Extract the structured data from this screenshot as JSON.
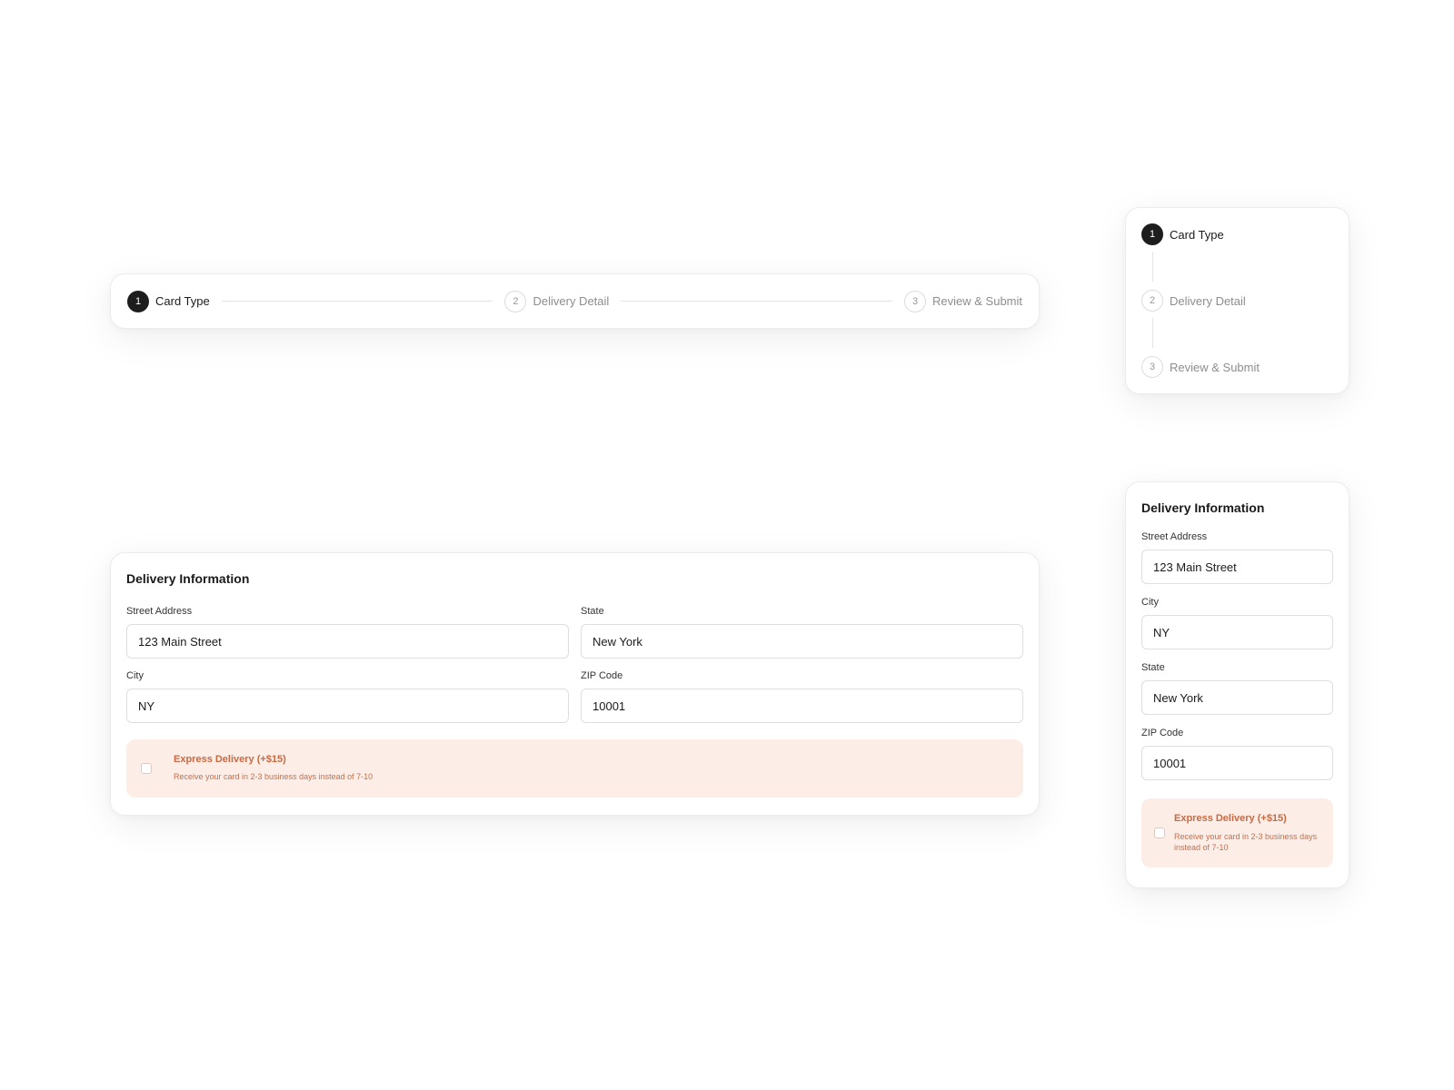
{
  "stepper": {
    "steps": [
      {
        "number": "1",
        "label": "Card Type",
        "state": "active"
      },
      {
        "number": "2",
        "label": "Delivery Detail",
        "state": "inactive"
      },
      {
        "number": "3",
        "label": "Review & Submit",
        "state": "inactive"
      }
    ]
  },
  "delivery_form": {
    "title": "Delivery Information",
    "fields": {
      "street": {
        "label": "Street Address",
        "value": "123 Main Street"
      },
      "city": {
        "label": "City",
        "value": "NY"
      },
      "state": {
        "label": "State",
        "value": "New York"
      },
      "zip": {
        "label": "ZIP Code",
        "value": "10001"
      }
    },
    "express": {
      "title": "Express Delivery (+$15)",
      "description": "Receive your card in 2-3 business days instead of 7-10",
      "checked": false
    }
  },
  "colors": {
    "active_step": "#1d1d1d",
    "express_bg": "#fcede6",
    "express_text": "#c76a44"
  }
}
